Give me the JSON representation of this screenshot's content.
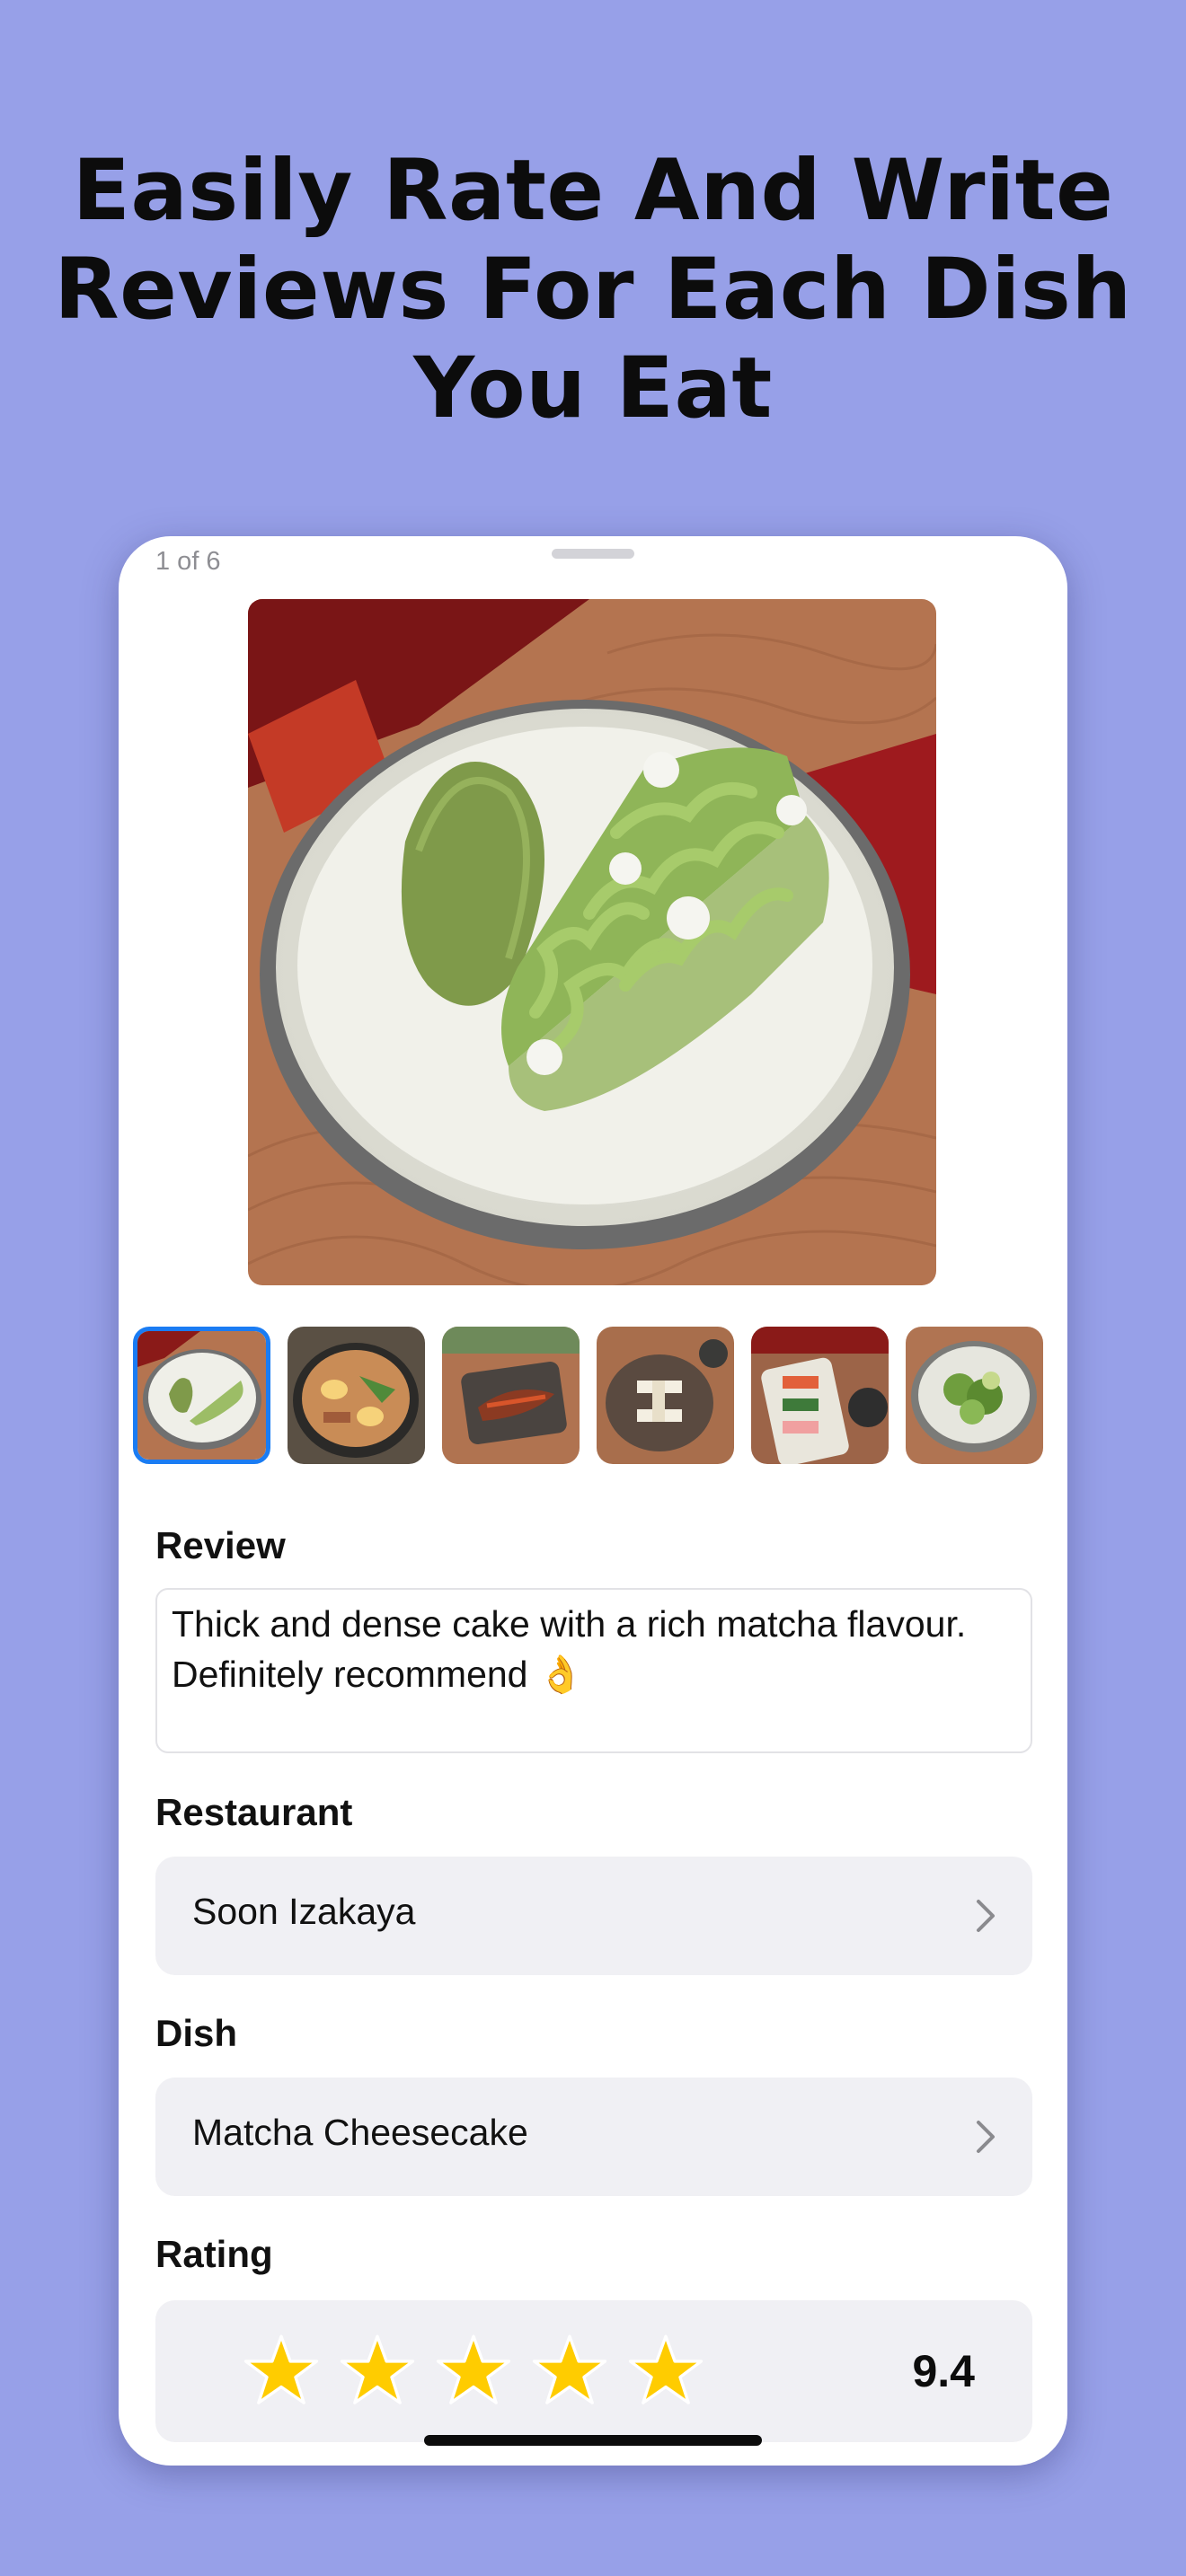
{
  "headline": "Easily Rate And Write Reviews For Each Dish You Eat",
  "sheet": {
    "counter": "1 of 6",
    "thumbnails": [
      {
        "name": "matcha-cheesecake",
        "selected": true
      },
      {
        "name": "ramen-bowl",
        "selected": false
      },
      {
        "name": "grilled-fish",
        "selected": false
      },
      {
        "name": "dessert-plate",
        "selected": false
      },
      {
        "name": "sushi-platter",
        "selected": false
      },
      {
        "name": "green-salad",
        "selected": false
      }
    ],
    "review": {
      "label": "Review",
      "text": "Thick and dense cake with a rich matcha flavour. Definitely recommend 👌"
    },
    "restaurant": {
      "label": "Restaurant",
      "value": "Soon Izakaya",
      "icon": "chevron-right-icon"
    },
    "dish": {
      "label": "Dish",
      "value": "Matcha Cheesecake",
      "icon": "chevron-right-icon"
    },
    "rating": {
      "label": "Rating",
      "stars": 5,
      "value": "9.4"
    }
  },
  "colors": {
    "background": "#97a0e8",
    "accent": "#1a7cf3",
    "star": "#ffcc00",
    "field_background": "#f0f0f4"
  }
}
